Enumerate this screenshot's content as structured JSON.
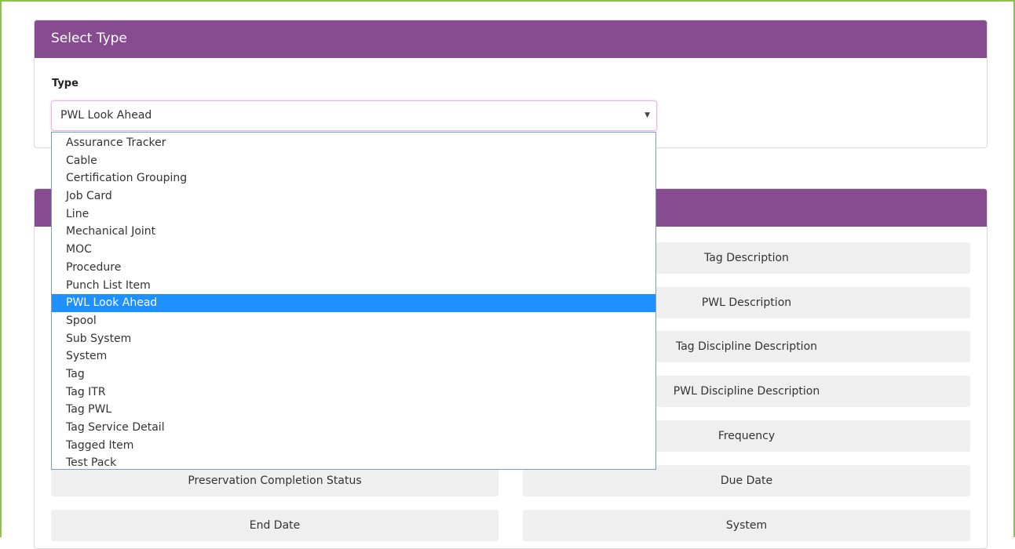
{
  "select_panel": {
    "title": "Select Type",
    "type_label": "Type",
    "selected_value": "PWL Look Ahead",
    "options": [
      "Assurance Tracker",
      "Cable",
      "Certification Grouping",
      "Job Card",
      "Line",
      "Mechanical Joint",
      "MOC",
      "Procedure",
      "Punch List Item",
      "PWL Look Ahead",
      "Spool",
      "Sub System",
      "System",
      "Tag",
      "Tag ITR",
      "Tag PWL",
      "Tag Service Detail",
      "Tagged Item",
      "Test Pack"
    ],
    "highlighted_index": 9
  },
  "fields_panel": {
    "title": "",
    "fields": {
      "tag_description": "Tag Description",
      "pwl_description": "PWL Description",
      "tag_discipline_description": "Tag Discipline Description",
      "pwl_discipline_description": "PWL Discipline Description",
      "frequency": "Frequency",
      "preservation_completion_status": "Preservation Completion Status",
      "due_date": "Due Date",
      "end_date": "End Date",
      "system": "System"
    }
  },
  "colors": {
    "header_purple": "#874b90",
    "highlight_blue": "#1e90ff",
    "frame_green": "#8bc34a",
    "field_gray": "#efefef"
  },
  "icons": {
    "select_caret": "▼"
  }
}
